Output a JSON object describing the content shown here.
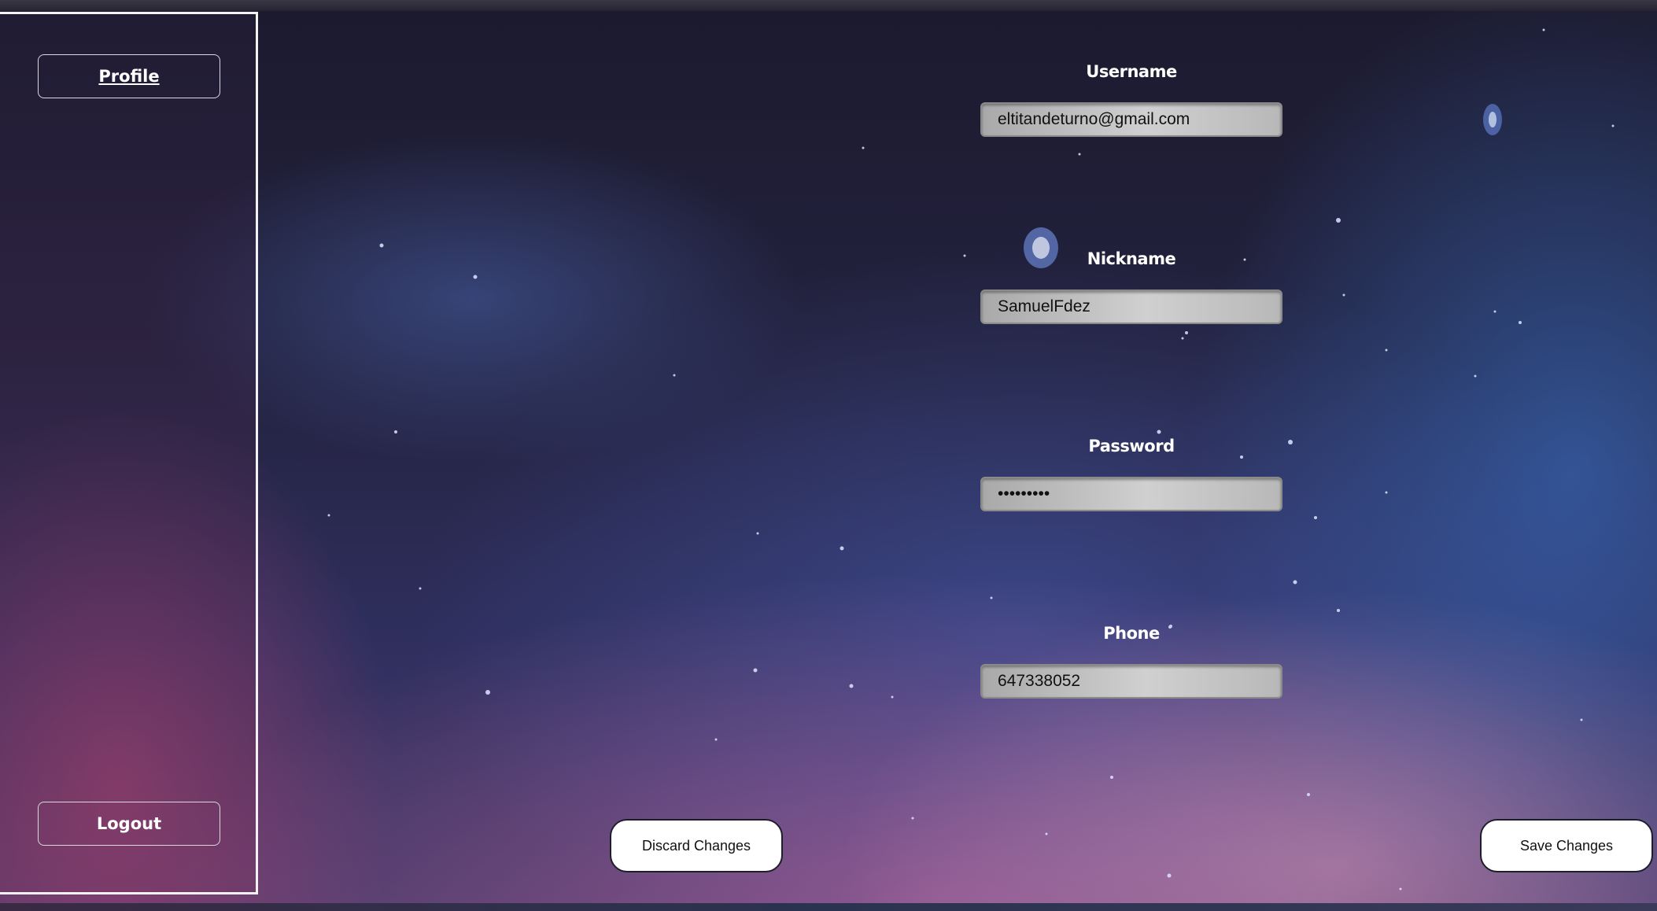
{
  "sidebar": {
    "profile_label": "Profile",
    "logout_label": "Logout"
  },
  "form": {
    "username": {
      "label": "Username",
      "value": "eltitandeturno@gmail.com"
    },
    "nickname": {
      "label": "Nickname",
      "value": "SamuelFdez"
    },
    "password": {
      "label": "Password",
      "value": "•••••••••"
    },
    "phone": {
      "label": "Phone",
      "value": "647338052"
    }
  },
  "actions": {
    "discard_label": "Discard Changes",
    "save_label": "Save Changes"
  },
  "colors": {
    "sidebar_border": "#f2f2f2",
    "input_fill": "#c8c8c8",
    "button_fill": "#ffffff"
  }
}
